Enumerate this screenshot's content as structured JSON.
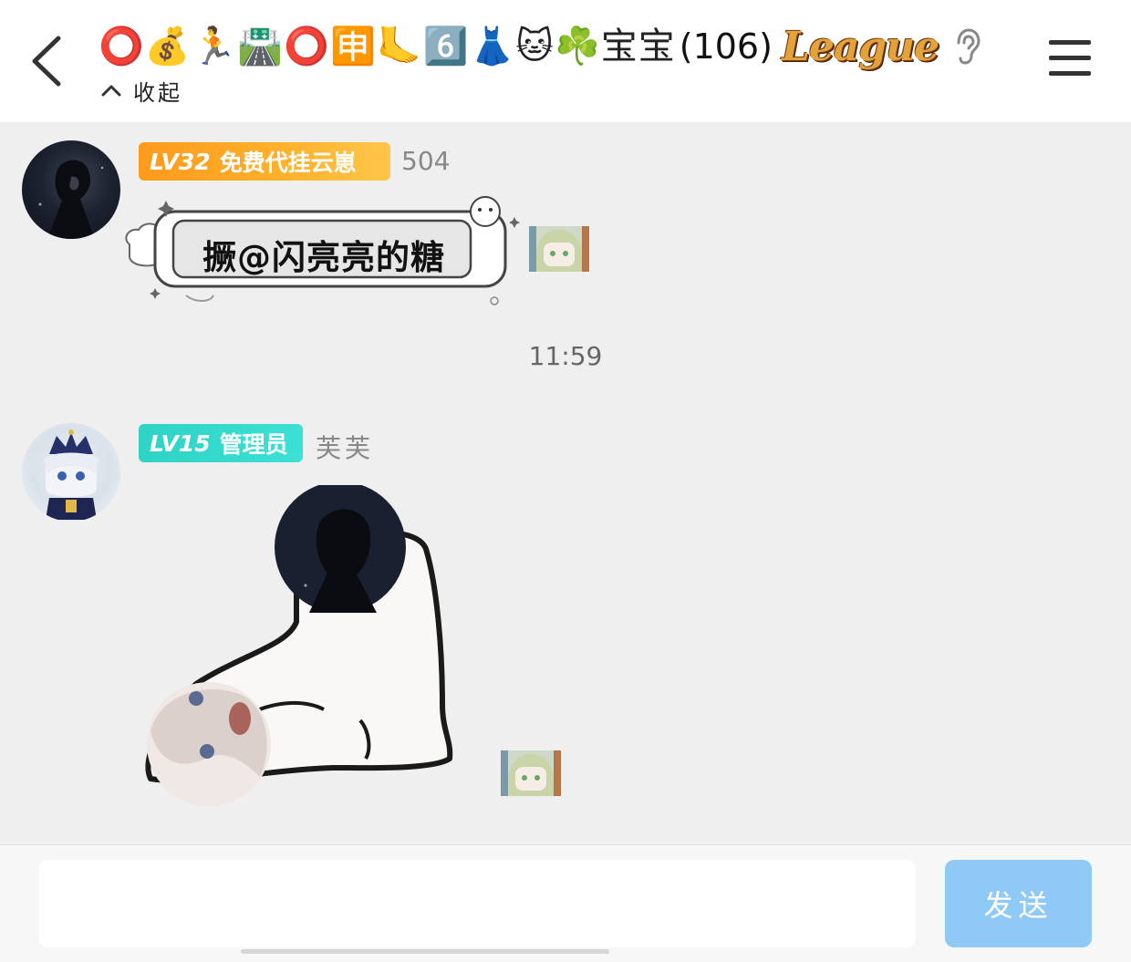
{
  "header": {
    "back_icon": "chevron-left-icon",
    "title_emojis": "⭕💰🏃🛣️⭕🈸🦶6️⃣👗🐱☘️宝宝",
    "title_count": "(106)",
    "title_logo_text": "League",
    "ear_icon": "ear-icon",
    "collapse_label": "收起",
    "collapse_icon": "chevron-up-icon",
    "menu_icon": "hamburger-menu-icon"
  },
  "messages": [
    {
      "badge_level": "LV32",
      "badge_title": "免费代挂云崽",
      "badge_color": "#ffa51f",
      "nickname": "504",
      "sticker_text": "撅@闪亮亮的糖"
    },
    {
      "badge_level": "LV15",
      "badge_title": "管理员",
      "badge_color": "#33d8cb",
      "nickname": "芙芙"
    }
  ],
  "timestamp": "11:59",
  "input": {
    "value": "",
    "placeholder": "",
    "send_label": "发送",
    "send_color": "#8fc9f5"
  }
}
